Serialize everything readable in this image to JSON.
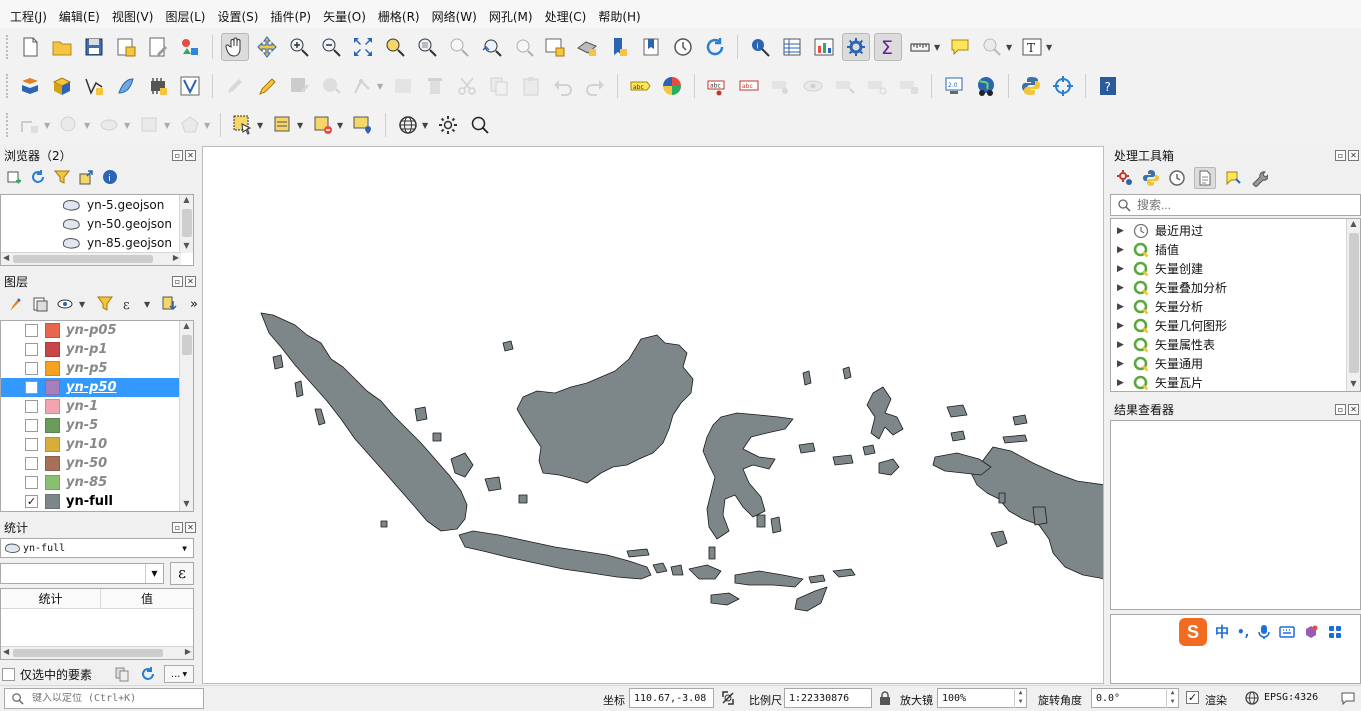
{
  "menu": [
    "工程(J)",
    "编辑(E)",
    "视图(V)",
    "图层(L)",
    "设置(S)",
    "插件(P)",
    "矢量(O)",
    "栅格(R)",
    "网络(W)",
    "网孔(M)",
    "处理(C)",
    "帮助(H)"
  ],
  "browser": {
    "title": "浏览器（2）",
    "items": [
      "yn-5.geojson",
      "yn-50.geojson",
      "yn-85.geojson"
    ]
  },
  "layers": {
    "title": "图层",
    "items": [
      {
        "name": "yn-p05",
        "color": "#e8674a",
        "checked": false,
        "selected": false
      },
      {
        "name": "yn-p1",
        "color": "#c84548",
        "checked": false,
        "selected": false
      },
      {
        "name": "yn-p5",
        "color": "#f5a122",
        "checked": false,
        "selected": false
      },
      {
        "name": "yn-p50",
        "color": "#a57fbf",
        "checked": false,
        "selected": true
      },
      {
        "name": "yn-1",
        "color": "#f2a4b1",
        "checked": false,
        "selected": false
      },
      {
        "name": "yn-5",
        "color": "#6a9c5e",
        "checked": false,
        "selected": false
      },
      {
        "name": "yn-10",
        "color": "#d8ad3a",
        "checked": false,
        "selected": false
      },
      {
        "name": "yn-50",
        "color": "#a8705a",
        "checked": false,
        "selected": false
      },
      {
        "name": "yn-85",
        "color": "#88c070",
        "checked": false,
        "selected": false
      },
      {
        "name": "yn-full",
        "color": "#7d878a",
        "checked": true,
        "selected": false
      }
    ]
  },
  "stats": {
    "title": "统计",
    "layer_value": "yn-full",
    "col_stat": "统计",
    "col_value": "值",
    "selected_only_label": "仅选中的要素",
    "more_label": "...",
    "epsilon": "ε"
  },
  "toolbox": {
    "title": "处理工具箱",
    "search_placeholder": "搜索...",
    "items": [
      "最近用过",
      "插值",
      "矢量创建",
      "矢量叠加分析",
      "矢量分析",
      "矢量几何图形",
      "矢量属性表",
      "矢量通用",
      "矢量瓦片"
    ]
  },
  "results": {
    "title": "结果查看器"
  },
  "ime": {
    "lang": "中",
    "punct": "•,"
  },
  "status": {
    "locate_placeholder": "键入以定位 (Ctrl+K)",
    "coord_label": "坐标",
    "coord_value": "110.67,-3.08",
    "scale_label": "比例尺",
    "scale_value": "1:22330876",
    "magnifier_label": "放大镜",
    "magnifier_value": "100%",
    "rotation_label": "旋转角度",
    "rotation_value": "0.0°",
    "render_label": "渲染",
    "crs_label": "EPSG:4326"
  },
  "map": {
    "fill_color": "#7d878a",
    "stroke_color": "#1a1a1a"
  }
}
